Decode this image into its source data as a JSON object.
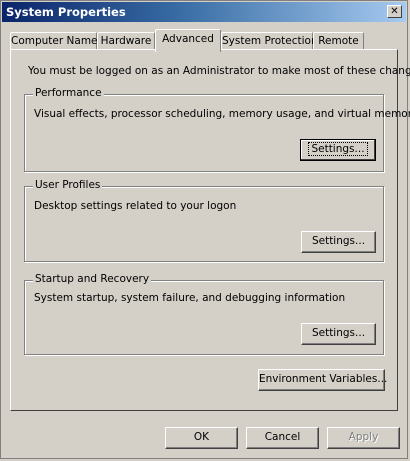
{
  "window": {
    "title": "System Properties",
    "close_glyph": "✕"
  },
  "tabs": [
    {
      "label": "Computer Name"
    },
    {
      "label": "Hardware"
    },
    {
      "label": "Advanced",
      "active": true
    },
    {
      "label": "System Protection"
    },
    {
      "label": "Remote"
    }
  ],
  "admin_note": "You must be logged on as an Administrator to make most of these changes.",
  "performance": {
    "legend": "Performance",
    "description": "Visual effects, processor scheduling, memory usage, and virtual memory",
    "button": "Settings..."
  },
  "user_profiles": {
    "legend": "User Profiles",
    "description": "Desktop settings related to your logon",
    "button": "Settings..."
  },
  "startup_recovery": {
    "legend": "Startup and Recovery",
    "description": "System startup, system failure, and debugging information",
    "button": "Settings..."
  },
  "environment_button": "Environment Variables...",
  "footer": {
    "ok": "OK",
    "cancel": "Cancel",
    "apply": "Apply"
  }
}
